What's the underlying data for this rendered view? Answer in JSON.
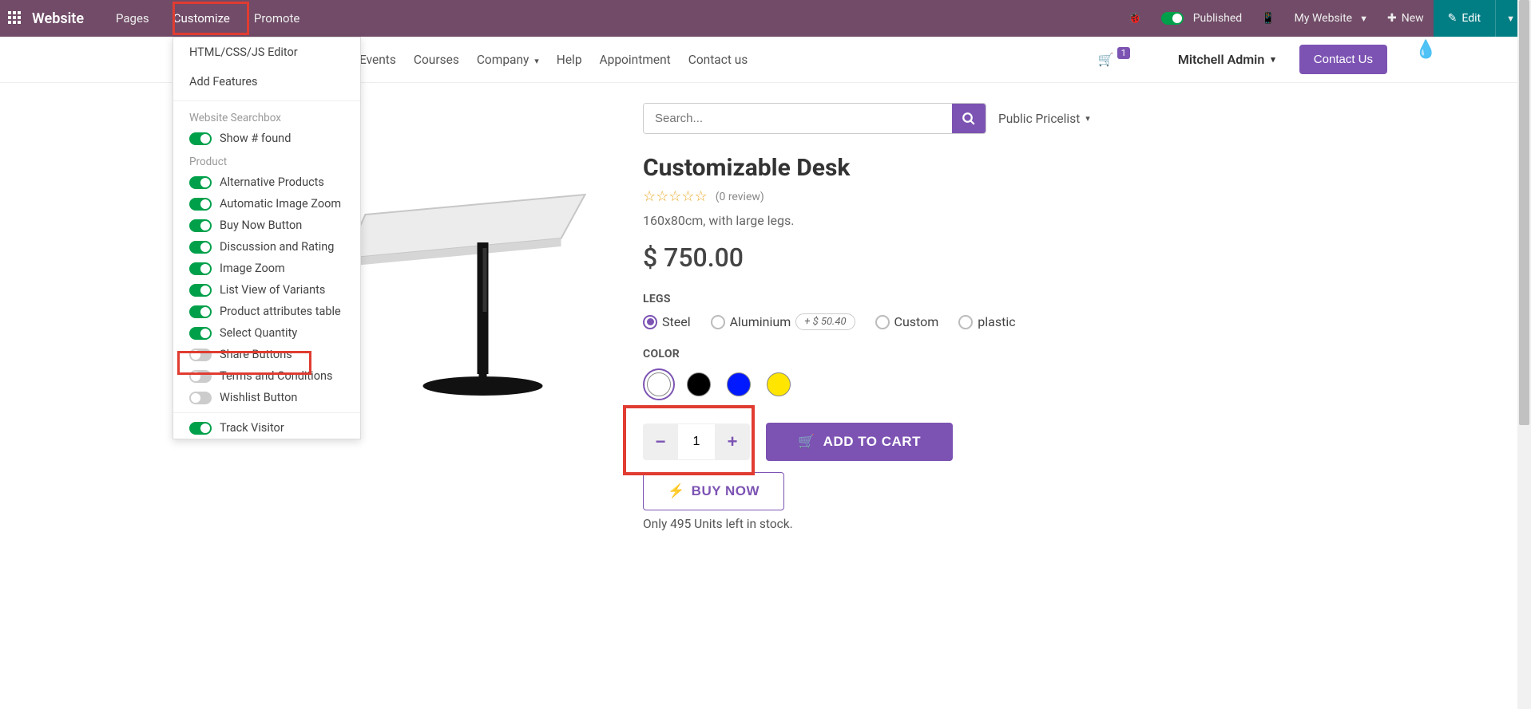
{
  "topbar": {
    "brand": "Website",
    "nav": {
      "pages": "Pages",
      "customize": "Customize",
      "promote": "Promote"
    },
    "published": "Published",
    "my_website": "My Website",
    "new": "New",
    "edit": "Edit"
  },
  "customize_menu": {
    "html_editor": "HTML/CSS/JS Editor",
    "add_features": "Add Features",
    "section_searchbox": "Website Searchbox",
    "show_found": "Show # found",
    "section_product": "Product",
    "alternative_products": "Alternative Products",
    "auto_zoom": "Automatic Image Zoom",
    "buy_now": "Buy Now Button",
    "discussion": "Discussion and Rating",
    "image_zoom": "Image Zoom",
    "list_variants": "List View of Variants",
    "attr_table": "Product attributes table",
    "select_quantity": "Select Quantity",
    "share_buttons": "Share Buttons",
    "terms": "Terms and Conditions",
    "wishlist": "Wishlist Button",
    "track_visitor": "Track Visitor"
  },
  "sitenav": {
    "events": "Events",
    "courses": "Courses",
    "company": "Company",
    "help": "Help",
    "appointment": "Appointment",
    "contact": "Contact us",
    "cart_count": "1",
    "user": "Mitchell Admin",
    "contact_btn": "Contact Us"
  },
  "search": {
    "placeholder": "Search...",
    "pricelist": "Public Pricelist"
  },
  "product": {
    "title": "Customizable Desk",
    "reviews": "(0 review)",
    "subtitle": "160x80cm, with large legs.",
    "price": "$ 750.00",
    "legs_label": "LEGS",
    "legs": {
      "steel": "Steel",
      "aluminium": "Aluminium",
      "aluminium_extra": "+  $ 50.40",
      "custom": "Custom",
      "plastic": "plastic"
    },
    "color_label": "COLOR",
    "qty_value": "1",
    "add_to_cart": "ADD TO CART",
    "buy_now": "BUY NOW",
    "stock": "Only 495 Units left in stock."
  }
}
